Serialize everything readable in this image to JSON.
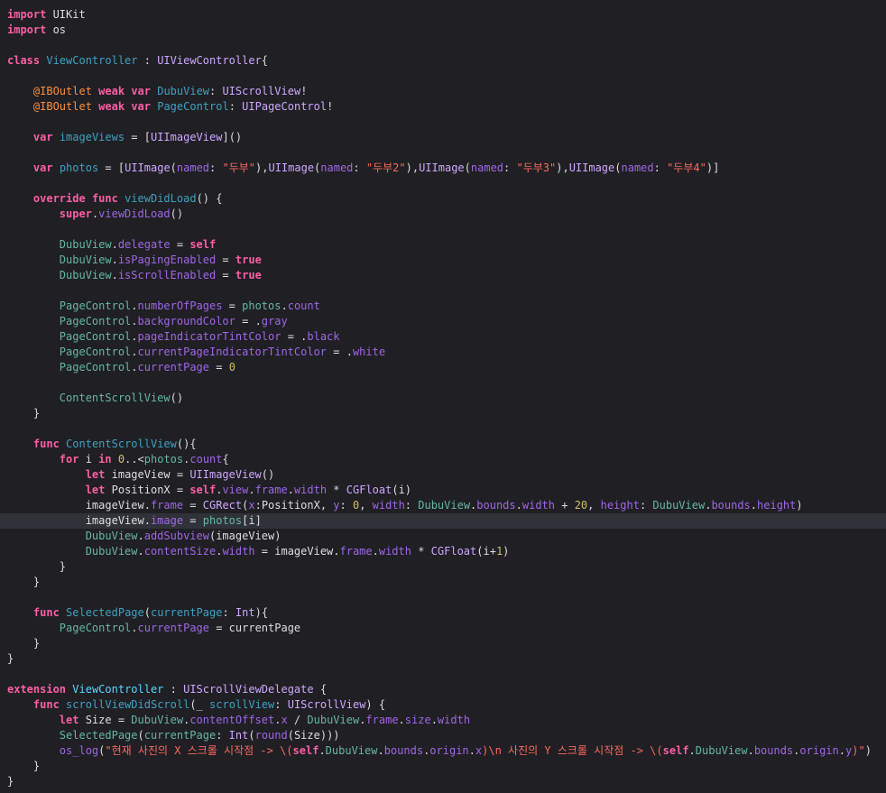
{
  "editor": {
    "current_line": 33,
    "colors": {
      "background": "#1f1f24",
      "current_line": "#2f3239",
      "keyword": "#fc5fa3",
      "string": "#fc6a5d",
      "number": "#d0bf69",
      "plain": "#dfdfe0"
    },
    "lines": [
      [
        [
          "kw",
          "import"
        ],
        [
          "p",
          " UIKit"
        ]
      ],
      [
        [
          "kw",
          "import"
        ],
        [
          "p",
          " os"
        ]
      ],
      [],
      [
        [
          "kw",
          "class"
        ],
        [
          "p",
          " "
        ],
        [
          "pdecl",
          "ViewController"
        ],
        [
          "p",
          " : "
        ],
        [
          "type",
          "UIViewController"
        ],
        [
          "p",
          "{"
        ]
      ],
      [],
      [
        [
          "p",
          "    "
        ],
        [
          "attr",
          "@IBOutlet"
        ],
        [
          "p",
          " "
        ],
        [
          "kw",
          "weak"
        ],
        [
          "p",
          " "
        ],
        [
          "kw",
          "var"
        ],
        [
          "p",
          " "
        ],
        [
          "pdecl",
          "DubuView"
        ],
        [
          "p",
          ": "
        ],
        [
          "type",
          "UIScrollView"
        ],
        [
          "p",
          "!"
        ]
      ],
      [
        [
          "p",
          "    "
        ],
        [
          "attr",
          "@IBOutlet"
        ],
        [
          "p",
          " "
        ],
        [
          "kw",
          "weak"
        ],
        [
          "p",
          " "
        ],
        [
          "kw",
          "var"
        ],
        [
          "p",
          " "
        ],
        [
          "pdecl",
          "PageControl"
        ],
        [
          "p",
          ": "
        ],
        [
          "type",
          "UIPageControl"
        ],
        [
          "p",
          "!"
        ]
      ],
      [],
      [
        [
          "p",
          "    "
        ],
        [
          "kw",
          "var"
        ],
        [
          "p",
          " "
        ],
        [
          "pdecl",
          "imageViews"
        ],
        [
          "p",
          " = ["
        ],
        [
          "type",
          "UIImageView"
        ],
        [
          "p",
          "]()"
        ]
      ],
      [],
      [
        [
          "p",
          "    "
        ],
        [
          "kw",
          "var"
        ],
        [
          "p",
          " "
        ],
        [
          "pdecl",
          "photos"
        ],
        [
          "p",
          " = ["
        ],
        [
          "type",
          "UIImage"
        ],
        [
          "p",
          "("
        ],
        [
          "var",
          "named"
        ],
        [
          "p",
          ": "
        ],
        [
          "str",
          "\"두부\""
        ],
        [
          "p",
          "),"
        ],
        [
          "type",
          "UIImage"
        ],
        [
          "p",
          "("
        ],
        [
          "var",
          "named"
        ],
        [
          "p",
          ": "
        ],
        [
          "str",
          "\"두부2\""
        ],
        [
          "p",
          "),"
        ],
        [
          "type",
          "UIImage"
        ],
        [
          "p",
          "("
        ],
        [
          "var",
          "named"
        ],
        [
          "p",
          ": "
        ],
        [
          "str",
          "\"두부3\""
        ],
        [
          "p",
          "),"
        ],
        [
          "type",
          "UIImage"
        ],
        [
          "p",
          "("
        ],
        [
          "var",
          "named"
        ],
        [
          "p",
          ": "
        ],
        [
          "str",
          "\"두부4\""
        ],
        [
          "p",
          ")]"
        ]
      ],
      [],
      [
        [
          "p",
          "    "
        ],
        [
          "kw",
          "override"
        ],
        [
          "p",
          " "
        ],
        [
          "kw",
          "func"
        ],
        [
          "p",
          " "
        ],
        [
          "pdecl",
          "viewDidLoad"
        ],
        [
          "p",
          "() {"
        ]
      ],
      [
        [
          "p",
          "        "
        ],
        [
          "kw",
          "super"
        ],
        [
          "p",
          "."
        ],
        [
          "var",
          "viewDidLoad"
        ],
        [
          "p",
          "()"
        ]
      ],
      [],
      [
        [
          "p",
          "        "
        ],
        [
          "pfunc",
          "DubuView"
        ],
        [
          "p",
          "."
        ],
        [
          "var",
          "delegate"
        ],
        [
          "p",
          " = "
        ],
        [
          "kw",
          "self"
        ]
      ],
      [
        [
          "p",
          "        "
        ],
        [
          "pfunc",
          "DubuView"
        ],
        [
          "p",
          "."
        ],
        [
          "var",
          "isPagingEnabled"
        ],
        [
          "p",
          " = "
        ],
        [
          "kw",
          "true"
        ]
      ],
      [
        [
          "p",
          "        "
        ],
        [
          "pfunc",
          "DubuView"
        ],
        [
          "p",
          "."
        ],
        [
          "var",
          "isScrollEnabled"
        ],
        [
          "p",
          " = "
        ],
        [
          "kw",
          "true"
        ]
      ],
      [],
      [
        [
          "p",
          "        "
        ],
        [
          "pfunc",
          "PageControl"
        ],
        [
          "p",
          "."
        ],
        [
          "var",
          "numberOfPages"
        ],
        [
          "p",
          " = "
        ],
        [
          "pfunc",
          "photos"
        ],
        [
          "p",
          "."
        ],
        [
          "var",
          "count"
        ]
      ],
      [
        [
          "p",
          "        "
        ],
        [
          "pfunc",
          "PageControl"
        ],
        [
          "p",
          "."
        ],
        [
          "var",
          "backgroundColor"
        ],
        [
          "p",
          " = ."
        ],
        [
          "var",
          "gray"
        ]
      ],
      [
        [
          "p",
          "        "
        ],
        [
          "pfunc",
          "PageControl"
        ],
        [
          "p",
          "."
        ],
        [
          "var",
          "pageIndicatorTintColor"
        ],
        [
          "p",
          " = ."
        ],
        [
          "var",
          "black"
        ]
      ],
      [
        [
          "p",
          "        "
        ],
        [
          "pfunc",
          "PageControl"
        ],
        [
          "p",
          "."
        ],
        [
          "var",
          "currentPageIndicatorTintColor"
        ],
        [
          "p",
          " = ."
        ],
        [
          "var",
          "white"
        ]
      ],
      [
        [
          "p",
          "        "
        ],
        [
          "pfunc",
          "PageControl"
        ],
        [
          "p",
          "."
        ],
        [
          "var",
          "currentPage"
        ],
        [
          "p",
          " = "
        ],
        [
          "num",
          "0"
        ]
      ],
      [],
      [
        [
          "p",
          "        "
        ],
        [
          "pfunc",
          "ContentScrollView"
        ],
        [
          "p",
          "()"
        ]
      ],
      [
        [
          "p",
          "    }"
        ]
      ],
      [],
      [
        [
          "p",
          "    "
        ],
        [
          "kw",
          "func"
        ],
        [
          "p",
          " "
        ],
        [
          "pdecl",
          "ContentScrollView"
        ],
        [
          "p",
          "(){"
        ]
      ],
      [
        [
          "p",
          "        "
        ],
        [
          "kw",
          "for"
        ],
        [
          "p",
          " i "
        ],
        [
          "kw",
          "in"
        ],
        [
          "p",
          " "
        ],
        [
          "num",
          "0"
        ],
        [
          "p",
          "..<"
        ],
        [
          "pfunc",
          "photos"
        ],
        [
          "p",
          "."
        ],
        [
          "var",
          "count"
        ],
        [
          "p",
          "{"
        ]
      ],
      [
        [
          "p",
          "            "
        ],
        [
          "kw",
          "let"
        ],
        [
          "p",
          " imageView = "
        ],
        [
          "type",
          "UIImageView"
        ],
        [
          "p",
          "()"
        ]
      ],
      [
        [
          "p",
          "            "
        ],
        [
          "kw",
          "let"
        ],
        [
          "p",
          " PositionX = "
        ],
        [
          "kw",
          "self"
        ],
        [
          "p",
          "."
        ],
        [
          "var",
          "view"
        ],
        [
          "p",
          "."
        ],
        [
          "var",
          "frame"
        ],
        [
          "p",
          "."
        ],
        [
          "var",
          "width"
        ],
        [
          "p",
          " * "
        ],
        [
          "type",
          "CGFloat"
        ],
        [
          "p",
          "(i)"
        ]
      ],
      [
        [
          "p",
          "            imageView."
        ],
        [
          "var",
          "frame"
        ],
        [
          "p",
          " = "
        ],
        [
          "type",
          "CGRect"
        ],
        [
          "p",
          "("
        ],
        [
          "var",
          "x"
        ],
        [
          "p",
          ":PositionX, "
        ],
        [
          "var",
          "y"
        ],
        [
          "p",
          ": "
        ],
        [
          "num",
          "0"
        ],
        [
          "p",
          ", "
        ],
        [
          "var",
          "width"
        ],
        [
          "p",
          ": "
        ],
        [
          "pfunc",
          "DubuView"
        ],
        [
          "p",
          "."
        ],
        [
          "var",
          "bounds"
        ],
        [
          "p",
          "."
        ],
        [
          "var",
          "width"
        ],
        [
          "p",
          " + "
        ],
        [
          "num",
          "20"
        ],
        [
          "p",
          ", "
        ],
        [
          "var",
          "height"
        ],
        [
          "p",
          ": "
        ],
        [
          "pfunc",
          "DubuView"
        ],
        [
          "p",
          "."
        ],
        [
          "var",
          "bounds"
        ],
        [
          "p",
          "."
        ],
        [
          "var",
          "height"
        ],
        [
          "p",
          ")"
        ]
      ],
      [
        [
          "p",
          "            imageView."
        ],
        [
          "var",
          "image"
        ],
        [
          "p",
          " = "
        ],
        [
          "pfunc",
          "photos"
        ],
        [
          "p",
          "[i]"
        ]
      ],
      [
        [
          "p",
          "            "
        ],
        [
          "pfunc",
          "DubuView"
        ],
        [
          "p",
          "."
        ],
        [
          "var",
          "addSubview"
        ],
        [
          "p",
          "(imageView)"
        ]
      ],
      [
        [
          "p",
          "            "
        ],
        [
          "pfunc",
          "DubuView"
        ],
        [
          "p",
          "."
        ],
        [
          "var",
          "contentSize"
        ],
        [
          "p",
          "."
        ],
        [
          "var",
          "width"
        ],
        [
          "p",
          " = imageView."
        ],
        [
          "var",
          "frame"
        ],
        [
          "p",
          "."
        ],
        [
          "var",
          "width"
        ],
        [
          "p",
          " * "
        ],
        [
          "type",
          "CGFloat"
        ],
        [
          "p",
          "(i+"
        ],
        [
          "num",
          "1"
        ],
        [
          "p",
          ")"
        ]
      ],
      [
        [
          "p",
          "        }"
        ]
      ],
      [
        [
          "p",
          "    }"
        ]
      ],
      [],
      [
        [
          "p",
          "    "
        ],
        [
          "kw",
          "func"
        ],
        [
          "p",
          " "
        ],
        [
          "pdecl",
          "SelectedPage"
        ],
        [
          "p",
          "("
        ],
        [
          "pdecl",
          "currentPage"
        ],
        [
          "p",
          ": "
        ],
        [
          "type",
          "Int"
        ],
        [
          "p",
          "){"
        ]
      ],
      [
        [
          "p",
          "        "
        ],
        [
          "pfunc",
          "PageControl"
        ],
        [
          "p",
          "."
        ],
        [
          "var",
          "currentPage"
        ],
        [
          "p",
          " = currentPage"
        ]
      ],
      [
        [
          "p",
          "    }"
        ]
      ],
      [
        [
          "p",
          "}"
        ]
      ],
      [],
      [
        [
          "kw",
          "extension"
        ],
        [
          "p",
          " "
        ],
        [
          "ptype",
          "ViewController"
        ],
        [
          "p",
          " : "
        ],
        [
          "type",
          "UIScrollViewDelegate"
        ],
        [
          "p",
          " {"
        ]
      ],
      [
        [
          "p",
          "    "
        ],
        [
          "kw",
          "func"
        ],
        [
          "p",
          " "
        ],
        [
          "pdecl",
          "scrollViewDidScroll"
        ],
        [
          "p",
          "(_ "
        ],
        [
          "pdecl",
          "scrollView"
        ],
        [
          "p",
          ": "
        ],
        [
          "type",
          "UIScrollView"
        ],
        [
          "p",
          ") {"
        ]
      ],
      [
        [
          "p",
          "        "
        ],
        [
          "kw",
          "let"
        ],
        [
          "p",
          " Size = "
        ],
        [
          "pfunc",
          "DubuView"
        ],
        [
          "p",
          "."
        ],
        [
          "var",
          "contentOffset"
        ],
        [
          "p",
          "."
        ],
        [
          "var",
          "x"
        ],
        [
          "p",
          " / "
        ],
        [
          "pfunc",
          "DubuView"
        ],
        [
          "p",
          "."
        ],
        [
          "var",
          "frame"
        ],
        [
          "p",
          "."
        ],
        [
          "var",
          "size"
        ],
        [
          "p",
          "."
        ],
        [
          "var",
          "width"
        ]
      ],
      [
        [
          "p",
          "        "
        ],
        [
          "pfunc",
          "SelectedPage"
        ],
        [
          "p",
          "("
        ],
        [
          "pfunc",
          "currentPage"
        ],
        [
          "p",
          ": "
        ],
        [
          "type",
          "Int"
        ],
        [
          "p",
          "("
        ],
        [
          "var",
          "round"
        ],
        [
          "p",
          "(Size)))"
        ]
      ],
      [
        [
          "p",
          "        "
        ],
        [
          "var",
          "os_log"
        ],
        [
          "p",
          "("
        ],
        [
          "str",
          "\"현재 사진의 X 스크롤 시작점 -> \\("
        ],
        [
          "kw",
          "self"
        ],
        [
          "p",
          "."
        ],
        [
          "pfunc",
          "DubuView"
        ],
        [
          "p",
          "."
        ],
        [
          "var",
          "bounds"
        ],
        [
          "p",
          "."
        ],
        [
          "var",
          "origin"
        ],
        [
          "p",
          "."
        ],
        [
          "var",
          "x"
        ],
        [
          "str",
          ")\\n 사진의 Y 스크롤 시작점 -> \\("
        ],
        [
          "kw",
          "self"
        ],
        [
          "p",
          "."
        ],
        [
          "pfunc",
          "DubuView"
        ],
        [
          "p",
          "."
        ],
        [
          "var",
          "bounds"
        ],
        [
          "p",
          "."
        ],
        [
          "var",
          "origin"
        ],
        [
          "p",
          "."
        ],
        [
          "var",
          "y"
        ],
        [
          "str",
          ")\""
        ],
        [
          "p",
          ")"
        ]
      ],
      [
        [
          "p",
          "    }"
        ]
      ],
      [
        [
          "p",
          "}"
        ]
      ]
    ]
  }
}
